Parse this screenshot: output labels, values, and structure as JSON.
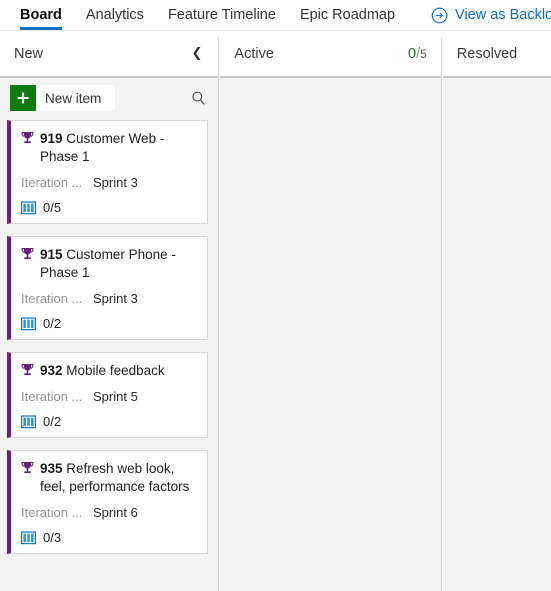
{
  "topnav": {
    "tabs": [
      {
        "label": "Board",
        "active": true
      },
      {
        "label": "Analytics",
        "active": false
      },
      {
        "label": "Feature Timeline",
        "active": false
      },
      {
        "label": "Epic Roadmap",
        "active": false
      }
    ],
    "action": {
      "label": "View as Backlog",
      "icon": "arrow-circle-right-icon"
    },
    "accent_color": "#0e70c0"
  },
  "toolbar": {
    "new_item_label": "New item",
    "new_item_icon": "plus-icon",
    "new_item_color": "#107c10",
    "search_icon": "search-icon"
  },
  "board": {
    "columns": [
      {
        "title": "New",
        "collapse_icon": "chevron-left-icon",
        "wip_current": null,
        "wip_limit": null
      },
      {
        "title": "Active",
        "collapse_icon": null,
        "wip_current": "0",
        "wip_separator": "/",
        "wip_limit": "5",
        "wip_current_color": "#107c10"
      },
      {
        "title": "Resolved",
        "collapse_icon": null,
        "wip_current": null,
        "wip_limit": null
      }
    ],
    "cards": [
      {
        "icon": "trophy-icon",
        "icon_color": "#68217a",
        "id": "919",
        "title": "Customer Web - Phase 1",
        "field_label": "Iteration ...",
        "field_value": "Sprint 3",
        "progress_icon": "story-book-icon",
        "progress_text": "0/5"
      },
      {
        "icon": "trophy-icon",
        "icon_color": "#68217a",
        "id": "915",
        "title": "Customer Phone - Phase 1",
        "field_label": "Iteration ...",
        "field_value": "Sprint 3",
        "progress_icon": "story-book-icon",
        "progress_text": "0/2"
      },
      {
        "icon": "trophy-icon",
        "icon_color": "#68217a",
        "id": "932",
        "title": "Mobile feedback",
        "field_label": "Iteration ...",
        "field_value": "Sprint 5",
        "progress_icon": "story-book-icon",
        "progress_text": "0/2"
      },
      {
        "icon": "trophy-icon",
        "icon_color": "#68217a",
        "id": "935",
        "title": "Refresh web look, feel, performance factors",
        "field_label": "Iteration ...",
        "field_value": "Sprint 6",
        "progress_icon": "story-book-icon",
        "progress_text": "0/3"
      }
    ]
  }
}
